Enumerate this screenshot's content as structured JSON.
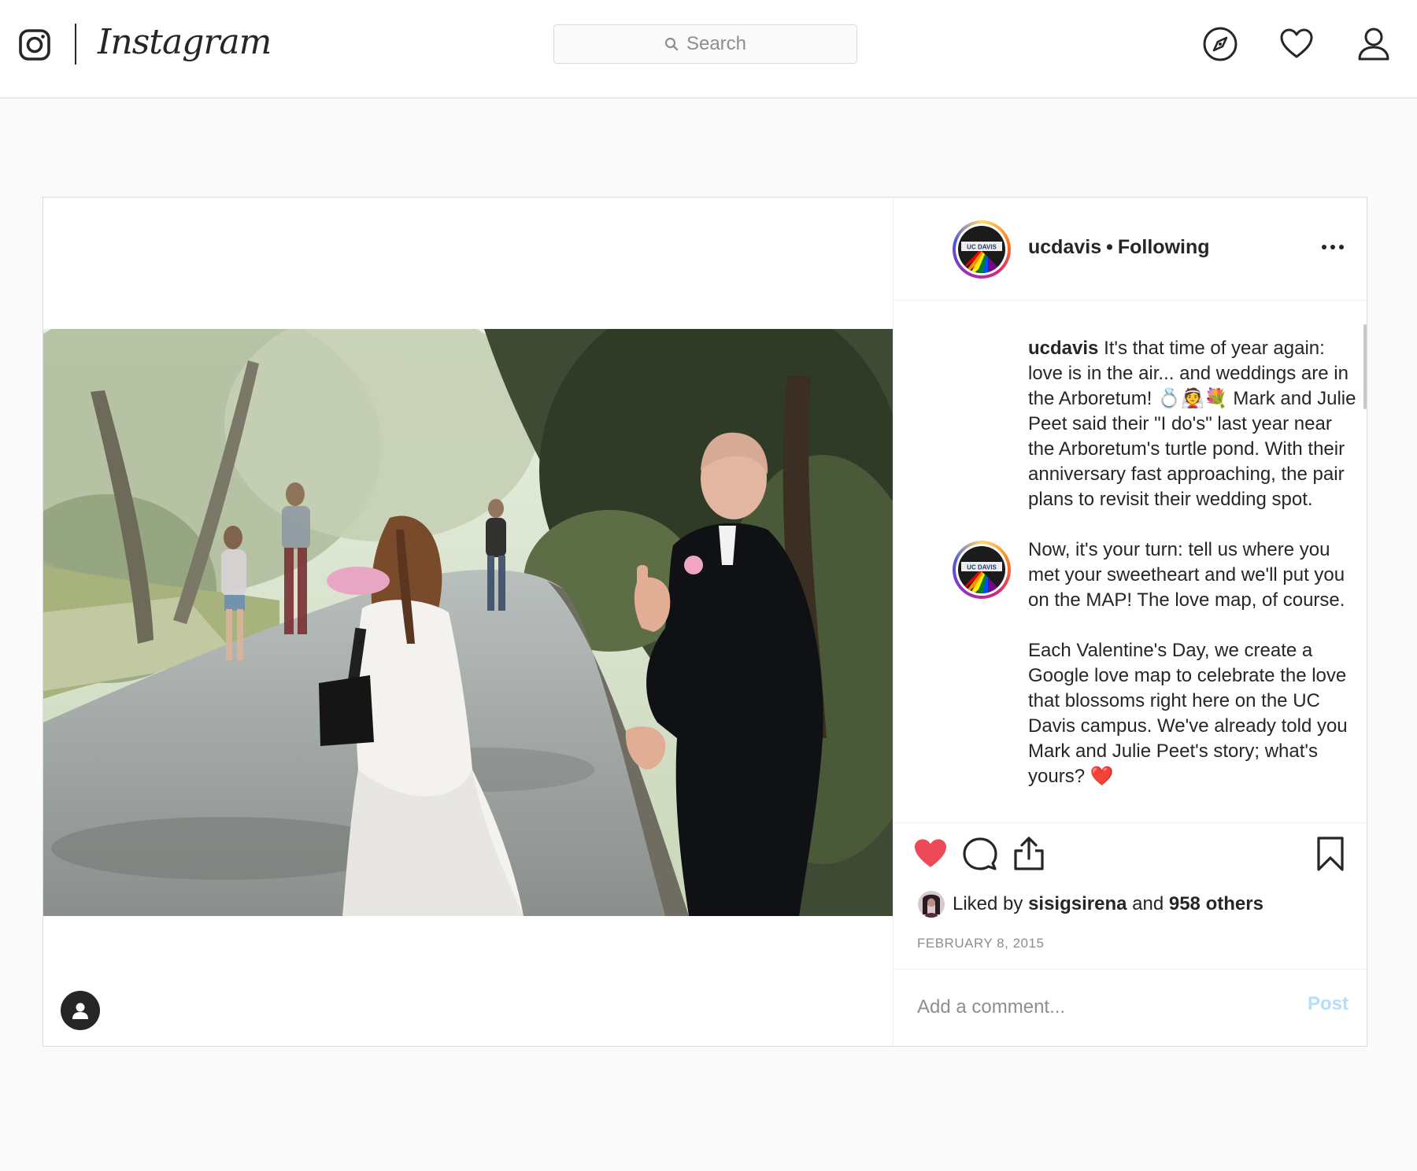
{
  "nav": {
    "brand": "Instagram",
    "search_placeholder": "Search",
    "icons": [
      "explore-icon",
      "activity-heart-icon",
      "profile-icon"
    ]
  },
  "post": {
    "username": "ucdavis",
    "separator": "•",
    "follow_status": "Following",
    "caption": {
      "username": "ucdavis",
      "paragraph1": "It's that time of year again: love is in the air... and weddings are in the Arboretum! 💍👰💐 Mark and Julie Peet said their \"I do's\" last year near the Arboretum's turtle pond. With their anniversary fast approaching, the pair plans to revisit their wedding spot.",
      "paragraph2": "Now, it's your turn: tell us where you met your sweetheart and we'll put you on the MAP! The love map, of course.",
      "paragraph3": "Each Valentine's Day, we create a Google love map to celebrate the love that blossoms right here on the UC Davis campus. We've already told you Mark and Julie Peet's story; what's yours? ❤️"
    },
    "likes": {
      "prefix": "Liked by",
      "user": "sisigsirena",
      "conjunction": "and",
      "others": "958 others"
    },
    "date": "FEBRUARY 8, 2015",
    "comment_placeholder": "Add a comment...",
    "post_button": "Post",
    "liked": true,
    "avatar_badge_text": "UC DAVIS"
  },
  "colors": {
    "like_red": "#ed4956",
    "post_button_disabled": "#b2dffc",
    "text": "#262626",
    "muted": "#8e8e8e"
  }
}
